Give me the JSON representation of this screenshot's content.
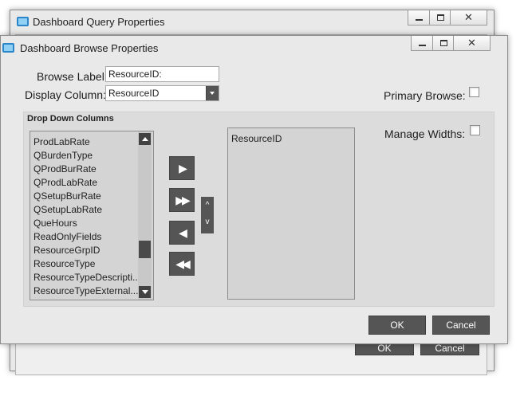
{
  "back_window": {
    "title": "Dashboard Query Properties",
    "ok_label": "OK",
    "cancel_label": "Cancel",
    "close_glyph": "✕"
  },
  "dialog": {
    "title": "Dashboard Browse Properties",
    "close_glyph": "✕",
    "browse_label": {
      "label": "Browse Label:",
      "value": "ResourceID:"
    },
    "display_column": {
      "label": "Display Column:",
      "value": "ResourceID"
    },
    "primary_browse": {
      "label": "Primary Browse:",
      "checked": false
    },
    "manage_widths": {
      "label": "Manage Widths:",
      "checked": false
    },
    "group_title": "Drop Down Columns",
    "available_columns": [
      "ProdLabRate",
      "QBurdenType",
      "QProdBurRate",
      "QProdLabRate",
      "QSetupBurRate",
      "QSetupLabRate",
      "QueHours",
      "ReadOnlyFields",
      "ResourceGrpID",
      "ResourceType",
      "ResourceTypeDescripti...",
      "ResourceTypeExternal..."
    ],
    "selected_columns": [
      "ResourceID"
    ],
    "move_buttons": {
      "add": "▶",
      "add_all": "▶▶",
      "remove": "◀",
      "remove_all": "◀◀",
      "up": "^",
      "down": "v"
    },
    "ok_label": "OK",
    "cancel_label": "Cancel"
  },
  "colors": {
    "window_bg": "#e9e9e9",
    "group_bg": "#dcdcdc",
    "dark_button": "#555555",
    "icon_blue": "#2b86c9"
  }
}
